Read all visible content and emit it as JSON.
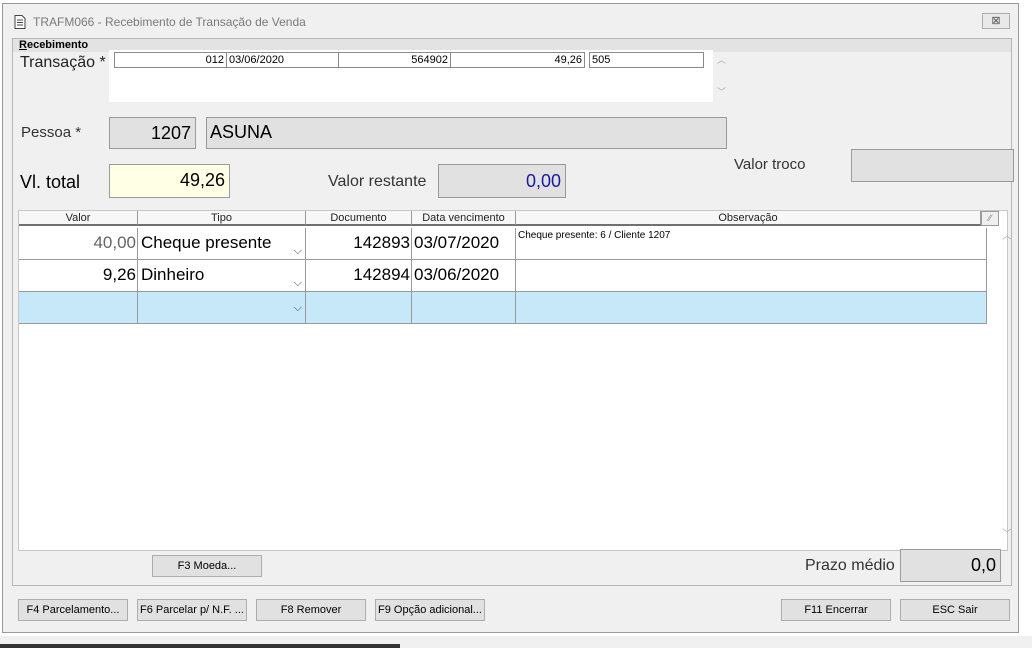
{
  "window": {
    "title": "TRAFM066 - Recebimento de Transação de Venda",
    "close_symbol": "⊠"
  },
  "group": {
    "title_first": "R",
    "title_rest": "ecebimento"
  },
  "transacao": {
    "label": "Transação *",
    "fields": [
      "012",
      "03/06/2020",
      "564902",
      "49,26",
      "505"
    ]
  },
  "pessoa": {
    "label": "Pessoa *",
    "code": "1207",
    "name": "ASUNA"
  },
  "totals": {
    "vl_total_label": "Vl. total",
    "vl_total": "49,26",
    "valor_restante_label": "Valor restante",
    "valor_restante": "0,00",
    "valor_troco_label": "Valor troco",
    "valor_troco": ""
  },
  "grid": {
    "headers": [
      "Valor",
      "Tipo",
      "Documento",
      "Data vencimento",
      "Observação"
    ],
    "corner_symbol": "⁄⁄",
    "rows": [
      {
        "valor": "40,00",
        "tipo": "Cheque presente",
        "documento": "142893",
        "data": "03/07/2020",
        "obs": "Cheque presente: 6 / Cliente 1207"
      },
      {
        "valor": "9,26",
        "tipo": "Dinheiro",
        "documento": "142894",
        "data": "03/06/2020",
        "obs": ""
      }
    ]
  },
  "footer": {
    "f3_moeda": "F3 Moeda...",
    "prazo_medio_label": "Prazo médio",
    "prazo_medio": "0,0"
  },
  "buttons": {
    "f4": "F4 Parcelamento...",
    "f6": "F6 Parcelar p/ N.F. ...",
    "f8": "F8 Remover",
    "f9": "F9 Opção adicional...",
    "f11": "F11 Encerrar",
    "esc": "ESC Sair"
  },
  "colors": {
    "window_bg": "#f0f0f0",
    "new_row_bg": "#c6e8f8",
    "total_field_bg": "#ffffe6",
    "valor_restante_text": "#1a1a9e"
  }
}
